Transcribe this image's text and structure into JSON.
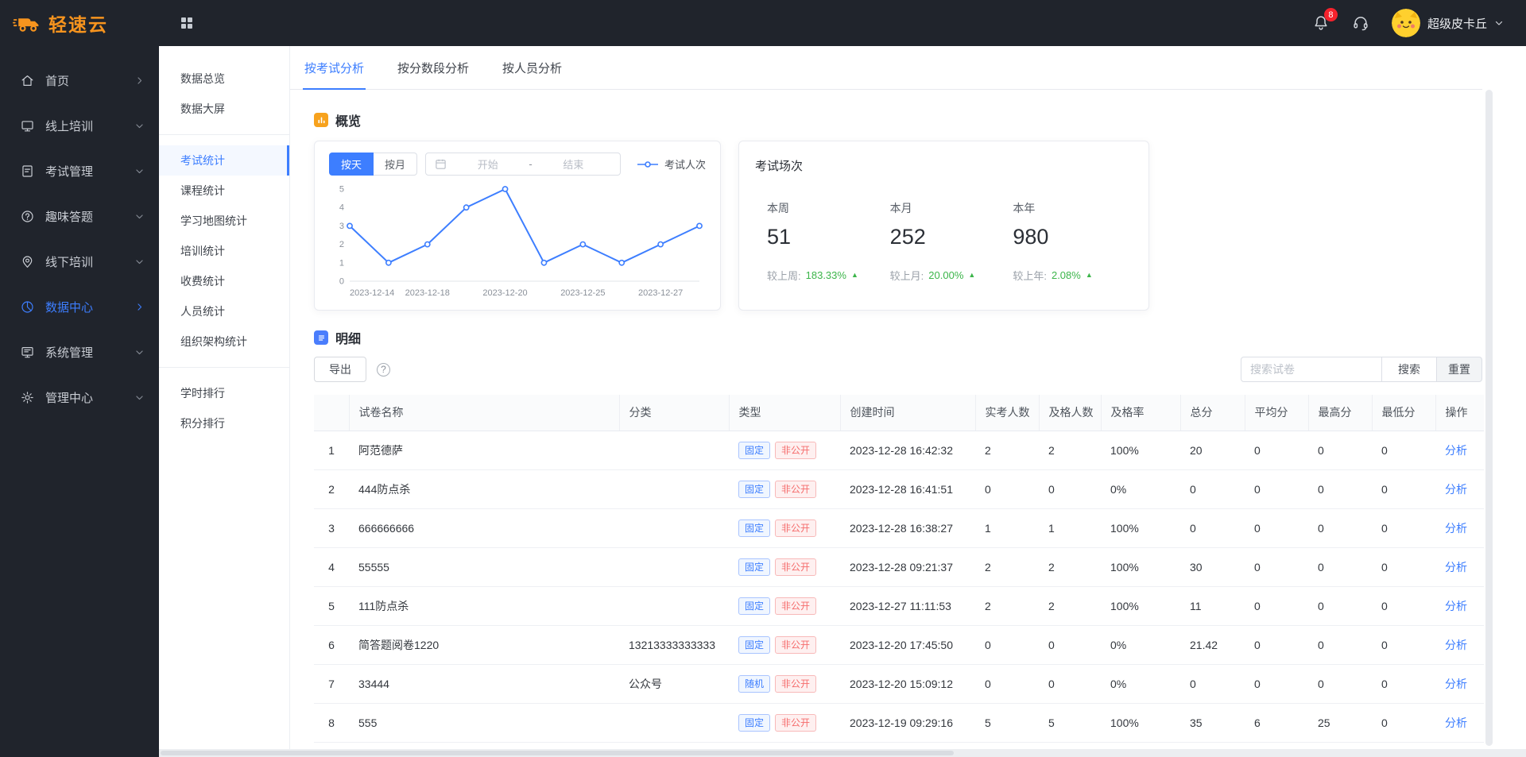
{
  "colors": {
    "accent": "#3D7EFF",
    "danger": "#F56C6C",
    "success": "#3CB54A",
    "brand": "#F7941E",
    "dark_bg": "#20242C"
  },
  "topbar": {
    "logo_text": "轻速云",
    "notification_count": "8",
    "user_name": "超级皮卡丘"
  },
  "sidebar": {
    "items": [
      {
        "label": "首页",
        "icon": "home-icon",
        "chevron": "right",
        "active": false
      },
      {
        "label": "线上培训",
        "icon": "online-training-icon",
        "chevron": "down",
        "active": false
      },
      {
        "label": "考试管理",
        "icon": "exam-management-icon",
        "chevron": "down",
        "active": false
      },
      {
        "label": "趣味答题",
        "icon": "quiz-icon",
        "chevron": "down",
        "active": false
      },
      {
        "label": "线下培训",
        "icon": "offline-training-icon",
        "chevron": "down",
        "active": false
      },
      {
        "label": "数据中心",
        "icon": "data-center-icon",
        "chevron": "right",
        "active": true
      },
      {
        "label": "系统管理",
        "icon": "system-management-icon",
        "chevron": "down",
        "active": false
      },
      {
        "label": "管理中心",
        "icon": "management-center-icon",
        "chevron": "down",
        "active": false
      }
    ]
  },
  "submenu": {
    "active_item": "考试统计",
    "groups": [
      {
        "items": [
          "数据总览",
          "数据大屏"
        ]
      },
      {
        "items": [
          "考试统计",
          "课程统计",
          "学习地图统计",
          "培训统计",
          "收费统计",
          "人员统计",
          "组织架构统计"
        ]
      },
      {
        "items": [
          "学时排行",
          "积分排行"
        ]
      }
    ]
  },
  "tabs": [
    {
      "label": "按考试分析",
      "active": true
    },
    {
      "label": "按分数段分析",
      "active": false
    },
    {
      "label": "按人员分析",
      "active": false
    }
  ],
  "overview": {
    "title": "概览",
    "filters": {
      "day": "按天",
      "month": "按月",
      "start_placeholder": "开始",
      "separator": "-",
      "end_placeholder": "结束"
    },
    "legend": "考试人次",
    "stats": {
      "title": "考试场次",
      "items": [
        {
          "period": "本周",
          "value": "51",
          "compare_label": "较上周:",
          "compare_value": "183.33%"
        },
        {
          "period": "本月",
          "value": "252",
          "compare_label": "较上月:",
          "compare_value": "20.00%"
        },
        {
          "period": "本年",
          "value": "980",
          "compare_label": "较上年:",
          "compare_value": "2.08%"
        }
      ]
    }
  },
  "chart_data": {
    "type": "line",
    "title": "考试人次",
    "series": [
      {
        "name": "考试人次",
        "values": [
          3,
          1,
          2,
          4,
          5,
          1,
          2,
          1,
          2,
          3
        ]
      }
    ],
    "x_tick_indices": [
      0,
      2,
      4,
      6,
      8
    ],
    "x_tick_labels": [
      "2023-12-14",
      "2023-12-18",
      "2023-12-20",
      "2023-12-25",
      "2023-12-27"
    ],
    "ylim": [
      0,
      5
    ],
    "y_ticks": [
      0,
      1,
      2,
      3,
      4,
      5
    ],
    "line_color": "#3D7EFF",
    "grid": false,
    "legend_position": "top-right"
  },
  "detail": {
    "title": "明细",
    "export_label": "导出",
    "help": "?",
    "search_placeholder": "搜索试卷",
    "search_label": "搜索",
    "reset_label": "重置",
    "table": {
      "columns": [
        "",
        "试卷名称",
        "分类",
        "类型",
        "创建时间",
        "实考人数",
        "及格人数",
        "及格率",
        "总分",
        "平均分",
        "最高分",
        "最低分",
        "操作"
      ],
      "action_label": "分析",
      "rows": [
        {
          "index": "1",
          "name": "阿范德萨",
          "category": "",
          "tags": [
            {
              "label": "固定",
              "kind": "primary"
            },
            {
              "label": "非公开",
              "kind": "danger"
            }
          ],
          "created": "2023-12-28 16:42:32",
          "taken": "2",
          "passed": "2",
          "rate": "100%",
          "total": "20",
          "avg": "0",
          "max": "0",
          "min": "0"
        },
        {
          "index": "2",
          "name": "444防点杀",
          "category": "",
          "tags": [
            {
              "label": "固定",
              "kind": "primary"
            },
            {
              "label": "非公开",
              "kind": "danger"
            }
          ],
          "created": "2023-12-28 16:41:51",
          "taken": "0",
          "passed": "0",
          "rate": "0%",
          "total": "0",
          "avg": "0",
          "max": "0",
          "min": "0"
        },
        {
          "index": "3",
          "name": "666666666",
          "category": "",
          "tags": [
            {
              "label": "固定",
              "kind": "primary"
            },
            {
              "label": "非公开",
              "kind": "danger"
            }
          ],
          "created": "2023-12-28 16:38:27",
          "taken": "1",
          "passed": "1",
          "rate": "100%",
          "total": "0",
          "avg": "0",
          "max": "0",
          "min": "0"
        },
        {
          "index": "4",
          "name": "55555",
          "category": "",
          "tags": [
            {
              "label": "固定",
              "kind": "primary"
            },
            {
              "label": "非公开",
              "kind": "danger"
            }
          ],
          "created": "2023-12-28 09:21:37",
          "taken": "2",
          "passed": "2",
          "rate": "100%",
          "total": "30",
          "avg": "0",
          "max": "0",
          "min": "0"
        },
        {
          "index": "5",
          "name": "111防点杀",
          "category": "",
          "tags": [
            {
              "label": "固定",
              "kind": "primary"
            },
            {
              "label": "非公开",
              "kind": "danger"
            }
          ],
          "created": "2023-12-27 11:11:53",
          "taken": "2",
          "passed": "2",
          "rate": "100%",
          "total": "11",
          "avg": "0",
          "max": "0",
          "min": "0"
        },
        {
          "index": "6",
          "name": "简答题阅卷1220",
          "category": "13213333333333",
          "tags": [
            {
              "label": "固定",
              "kind": "primary"
            },
            {
              "label": "非公开",
              "kind": "danger"
            }
          ],
          "created": "2023-12-20 17:45:50",
          "taken": "0",
          "passed": "0",
          "rate": "0%",
          "total": "21.42",
          "avg": "0",
          "max": "0",
          "min": "0"
        },
        {
          "index": "7",
          "name": "33444",
          "category": "公众号",
          "tags": [
            {
              "label": "随机",
              "kind": "primary"
            },
            {
              "label": "非公开",
              "kind": "danger"
            }
          ],
          "created": "2023-12-20 15:09:12",
          "taken": "0",
          "passed": "0",
          "rate": "0%",
          "total": "0",
          "avg": "0",
          "max": "0",
          "min": "0"
        },
        {
          "index": "8",
          "name": "555",
          "category": "",
          "tags": [
            {
              "label": "固定",
              "kind": "primary"
            },
            {
              "label": "非公开",
              "kind": "danger"
            }
          ],
          "created": "2023-12-19 09:29:16",
          "taken": "5",
          "passed": "5",
          "rate": "100%",
          "total": "35",
          "avg": "6",
          "max": "25",
          "min": "0"
        }
      ]
    }
  }
}
